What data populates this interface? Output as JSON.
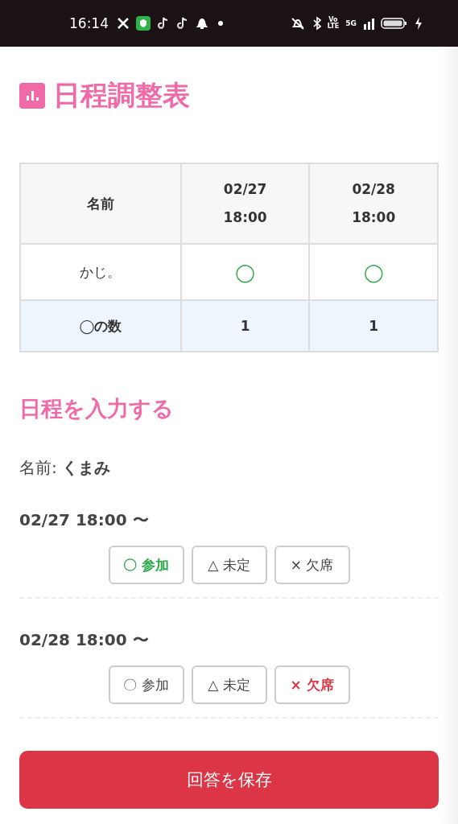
{
  "status_bar": {
    "time": "16:14",
    "volte": [
      "Vo",
      "LTE"
    ],
    "network": "5G"
  },
  "title": "日程調整表",
  "table": {
    "columns": [
      {
        "lines": [
          "名前"
        ]
      },
      {
        "lines": [
          "02/27",
          "18:00"
        ]
      },
      {
        "lines": [
          "02/28",
          "18:00"
        ]
      }
    ],
    "rows": [
      {
        "kind": "entry",
        "cells": [
          "かじ。",
          "◯",
          "◯"
        ]
      },
      {
        "kind": "count",
        "cells": [
          "◯の数",
          "1",
          "1"
        ]
      }
    ]
  },
  "form": {
    "title": "日程を入力する",
    "name_label": "名前:",
    "name_value": "くまみ",
    "dates": [
      {
        "label": "02/27 18:00 〜",
        "choices": [
          {
            "kind": "yes",
            "label": "〇 参加",
            "selected": true
          },
          {
            "kind": "maybe",
            "label": "△ 未定",
            "selected": false
          },
          {
            "kind": "no",
            "label": "× 欠席",
            "selected": false
          }
        ]
      },
      {
        "label": "02/28 18:00 〜",
        "choices": [
          {
            "kind": "yes",
            "label": "〇 参加",
            "selected": false
          },
          {
            "kind": "maybe",
            "label": "△ 未定",
            "selected": false
          },
          {
            "kind": "no",
            "label": "× 欠席",
            "selected": true
          }
        ]
      }
    ],
    "save": "回答を保存"
  }
}
